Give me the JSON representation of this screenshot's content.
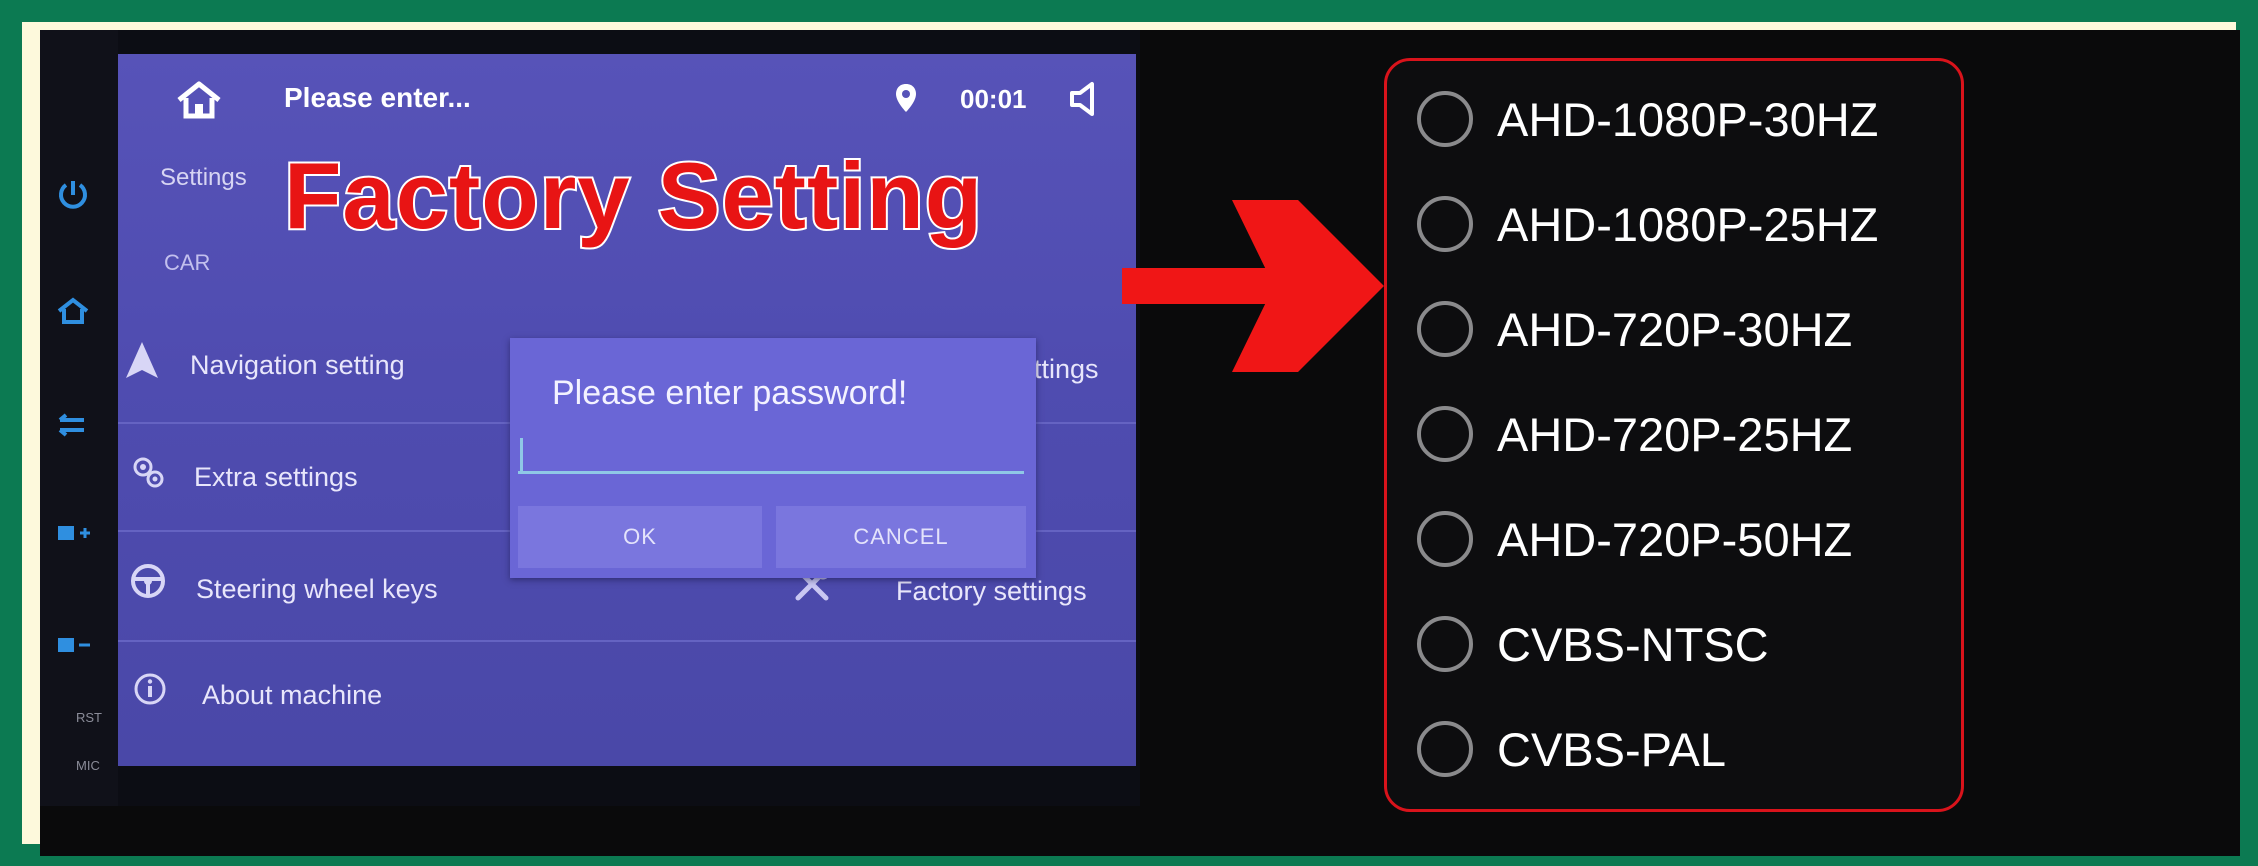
{
  "status_bar": {
    "title": "Please enter...",
    "time": "00:01"
  },
  "settings_screen": {
    "settings_label": "Settings",
    "car_label": "CAR",
    "factory_title": "Factory Setting",
    "menu_items": [
      {
        "label": "Navigation setting",
        "icon": "navigation-arrow-icon"
      },
      {
        "label": "ttings",
        "icon": ""
      },
      {
        "label": "Extra settings",
        "icon": "gears-icon"
      },
      {
        "label": "Steering wheel keys",
        "icon": "steering-wheel-icon"
      },
      {
        "label": "Factory settings",
        "icon": "tools-icon"
      },
      {
        "label": "About machine",
        "icon": "info-icon"
      }
    ]
  },
  "side_keys": {
    "rst_label": "RST",
    "mic_label": "MIC"
  },
  "password_dialog": {
    "title": "Please enter password!",
    "input_value": "",
    "ok_label": "OK",
    "cancel_label": "CANCEL"
  },
  "resolution_options": [
    {
      "label": "AHD-1080P-30HZ",
      "selected": false
    },
    {
      "label": "AHD-1080P-25HZ",
      "selected": false
    },
    {
      "label": "AHD-720P-30HZ",
      "selected": false
    },
    {
      "label": "AHD-720P-25HZ",
      "selected": false
    },
    {
      "label": "AHD-720P-50HZ",
      "selected": false
    },
    {
      "label": "CVBS-NTSC",
      "selected": false
    },
    {
      "label": "CVBS-PAL",
      "selected": false
    }
  ],
  "colors": {
    "background_green": "#0c7a52",
    "frame_cream": "#fdf9dc",
    "screen_purple": "#5753b8",
    "title_red": "#e81414",
    "arrow_red": "#f01616",
    "side_key_blue": "#2f8fe0",
    "panel_border_red": "#d9131b"
  }
}
